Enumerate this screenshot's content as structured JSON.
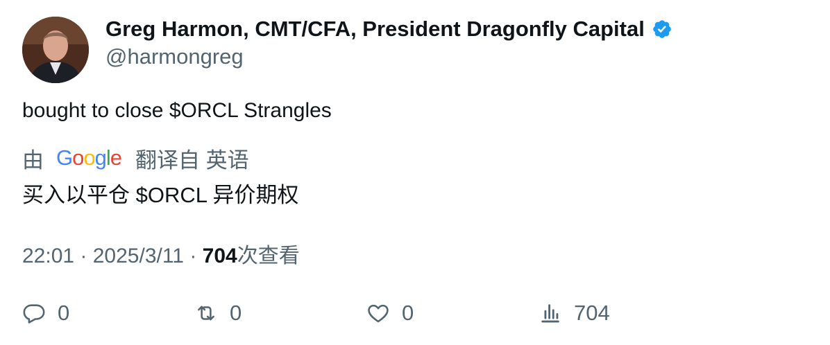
{
  "author": {
    "display_name": "Greg Harmon, CMT/CFA, President Dragonfly Capital",
    "handle": "@harmongreg",
    "verified_icon": "verified-badge-icon",
    "verified_color": "#1d9bf0"
  },
  "tweet": {
    "text": "bought to close $ORCL Strangles"
  },
  "translation": {
    "by_label": "由",
    "provider": "Google",
    "from_label": "翻译自 英语",
    "text": "买入以平仓 $ORCL 异价期权"
  },
  "meta": {
    "time": "22:01",
    "separator1": " · ",
    "date": "2025/3/11",
    "separator2": " · ",
    "views_count": "704",
    "views_label": "次查看"
  },
  "actions": {
    "reply_count": "0",
    "retweet_count": "0",
    "like_count": "0",
    "views_count": "704"
  },
  "colors": {
    "text_primary": "#0f1419",
    "text_secondary": "#536471",
    "google_blue": "#4285F4",
    "google_red": "#EA4335",
    "google_yellow": "#FBBC05",
    "google_green": "#34A853"
  }
}
